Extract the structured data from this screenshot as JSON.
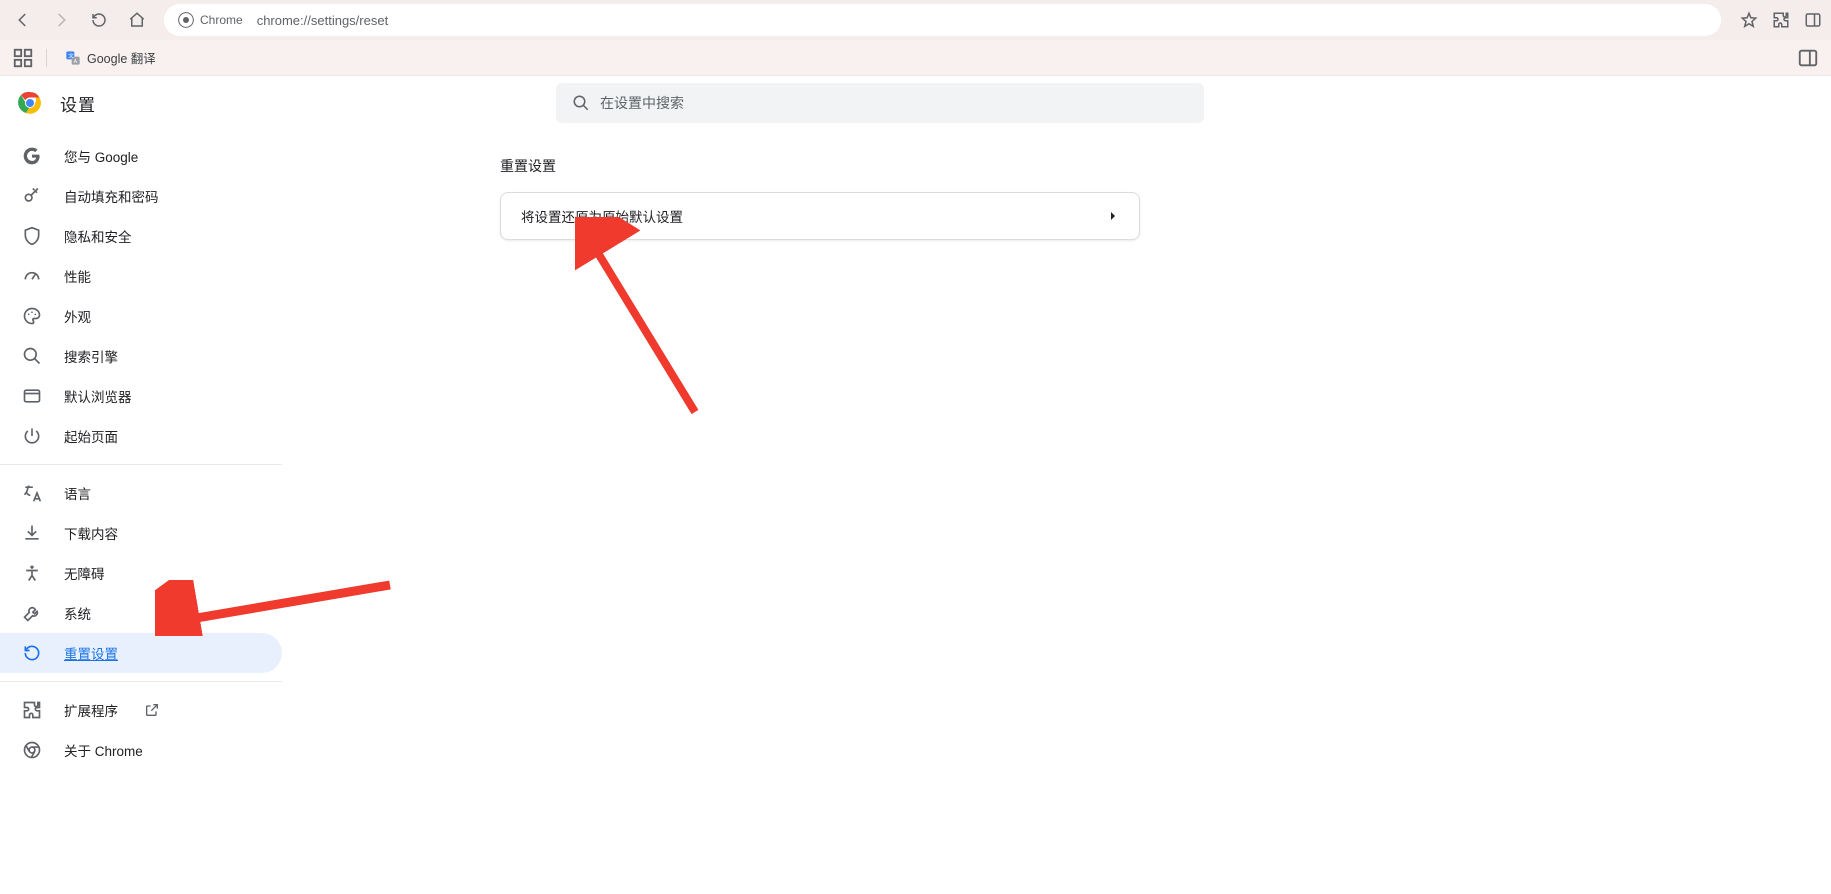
{
  "browser": {
    "url_chip": "Chrome",
    "url": "chrome://settings/reset"
  },
  "bookmarks": {
    "item1": "Google 翻译"
  },
  "header": {
    "title": "设置",
    "search_placeholder": "在设置中搜索"
  },
  "sidebar": {
    "you_and_google": "您与 Google",
    "autofill": "自动填充和密码",
    "privacy": "隐私和安全",
    "performance": "性能",
    "appearance": "外观",
    "search_engine": "搜索引擎",
    "default_browser": "默认浏览器",
    "on_startup": "起始页面",
    "language": "语言",
    "downloads": "下载内容",
    "accessibility": "无障碍",
    "system": "系统",
    "reset": "重置设置",
    "extensions": "扩展程序",
    "about": "关于 Chrome"
  },
  "content": {
    "section_title": "重置设置",
    "reset_row": "将设置还原为原始默认设置"
  }
}
